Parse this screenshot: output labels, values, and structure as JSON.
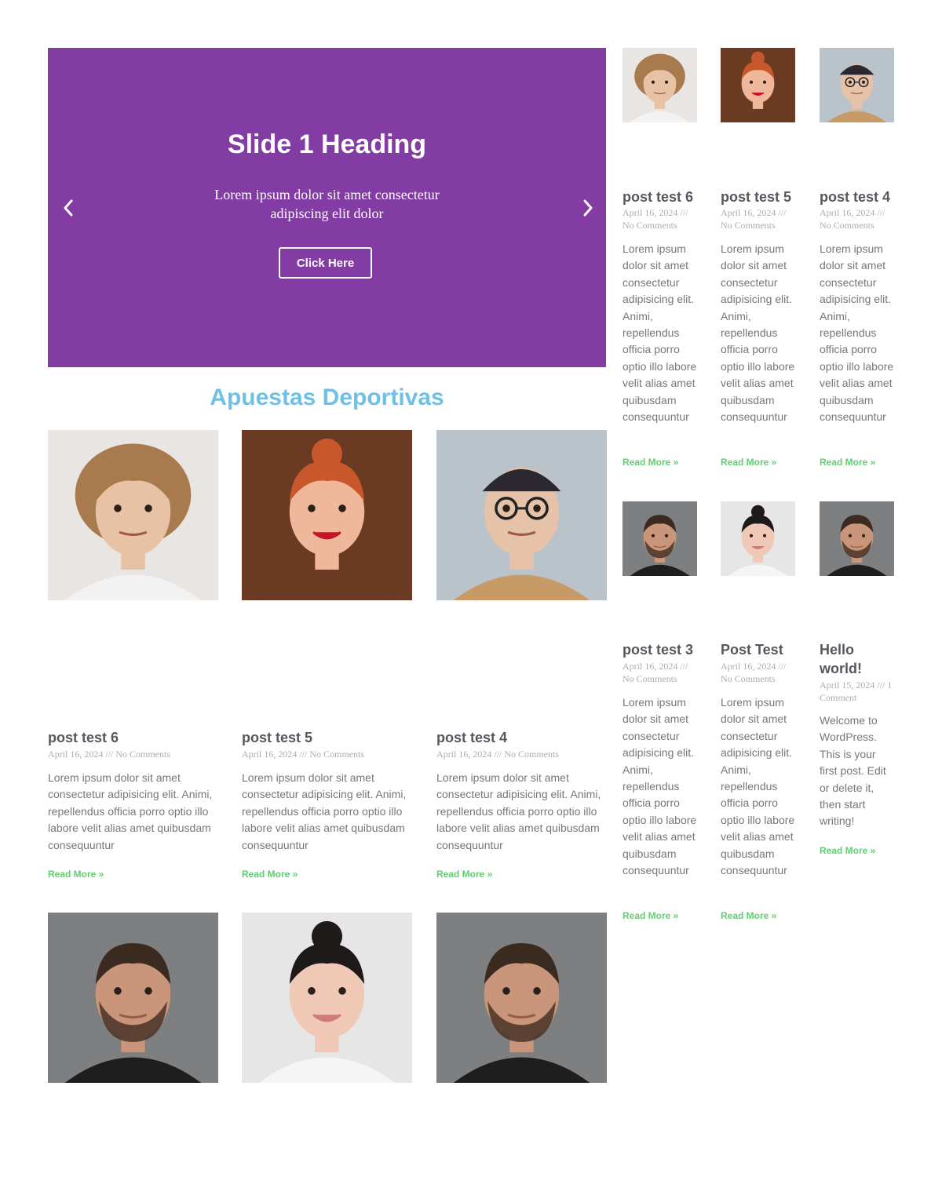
{
  "slider": {
    "heading": "Slide 1 Heading",
    "text": "Lorem ipsum dolor sit amet consectetur adipiscing elit dolor",
    "button_label": "Click Here",
    "background": "#833ca3"
  },
  "section_title": "Apuestas Deportivas",
  "colors": {
    "accent_blue": "#6ec1e4",
    "read_more_green": "#61ce70",
    "title_gray": "#54595f",
    "text_gray": "#777777"
  },
  "main_posts": [
    {
      "title": "post test 6",
      "meta": "April 16, 2024 /// No Comments",
      "excerpt": "Lorem ipsum dolor sit amet consectetur adipisicing elit. Animi, repellendus officia porro optio illo labore velit alias amet quibusdam consequuntur",
      "read_more": "Read More »",
      "avatar": "curly-hair-man"
    },
    {
      "title": "post test 5",
      "meta": "April 16, 2024 /// No Comments",
      "excerpt": "Lorem ipsum dolor sit amet consectetur adipisicing elit. Animi, repellendus officia porro optio illo labore velit alias amet quibusdam consequuntur",
      "read_more": "Read More »",
      "avatar": "red-hair-woman"
    },
    {
      "title": "post test 4",
      "meta": "April 16, 2024 /// No Comments",
      "excerpt": "Lorem ipsum dolor sit amet consectetur adipisicing elit. Animi, repellendus officia porro optio illo labore velit alias amet quibusdam consequuntur",
      "read_more": "Read More »",
      "avatar": "glasses-man"
    }
  ],
  "main_bottom_avatars": [
    "bearded-man",
    "dark-hair-woman",
    "bearded-man"
  ],
  "side_posts": [
    {
      "title": "post test 6",
      "meta": "April 16, 2024 /// No Comments",
      "excerpt": "Lorem ipsum dolor sit amet consectetur adipisicing elit. Animi, repellendus officia porro optio illo labore velit alias amet quibusdam consequuntur",
      "read_more": "Read More »",
      "avatar": "curly-hair-man"
    },
    {
      "title": "post test 5",
      "meta": "April 16, 2024 /// No Comments",
      "excerpt": "Lorem ipsum dolor sit amet consectetur adipisicing elit. Animi, repellendus officia porro optio illo labore velit alias amet quibusdam consequuntur",
      "read_more": "Read More »",
      "avatar": "red-hair-woman"
    },
    {
      "title": "post test 4",
      "meta": "April 16, 2024 /// No Comments",
      "excerpt": "Lorem ipsum dolor sit amet consectetur adipisicing elit. Animi, repellendus officia porro optio illo labore velit alias amet quibusdam consequuntur",
      "read_more": "Read More »",
      "avatar": "glasses-man"
    },
    {
      "title": "post test 3",
      "meta": "April 16, 2024 /// No Comments",
      "excerpt": "Lorem ipsum dolor sit amet consectetur adipisicing elit. Animi, repellendus officia porro optio illo labore velit alias amet quibusdam consequuntur",
      "read_more": "Read More »",
      "avatar": "bearded-man"
    },
    {
      "title": "Post Test",
      "meta": "April 16, 2024 /// No Comments",
      "excerpt": "Lorem ipsum dolor sit amet consectetur adipisicing elit. Animi, repellendus officia porro optio illo labore velit alias amet quibusdam consequuntur",
      "read_more": "Read More »",
      "avatar": "dark-hair-woman"
    },
    {
      "title": "Hello world!",
      "meta": "April 15, 2024 /// 1 Comment",
      "excerpt": "Welcome to WordPress. This is your first post. Edit or delete it, then start writing!",
      "read_more": "Read More »",
      "avatar": "bearded-man"
    }
  ]
}
